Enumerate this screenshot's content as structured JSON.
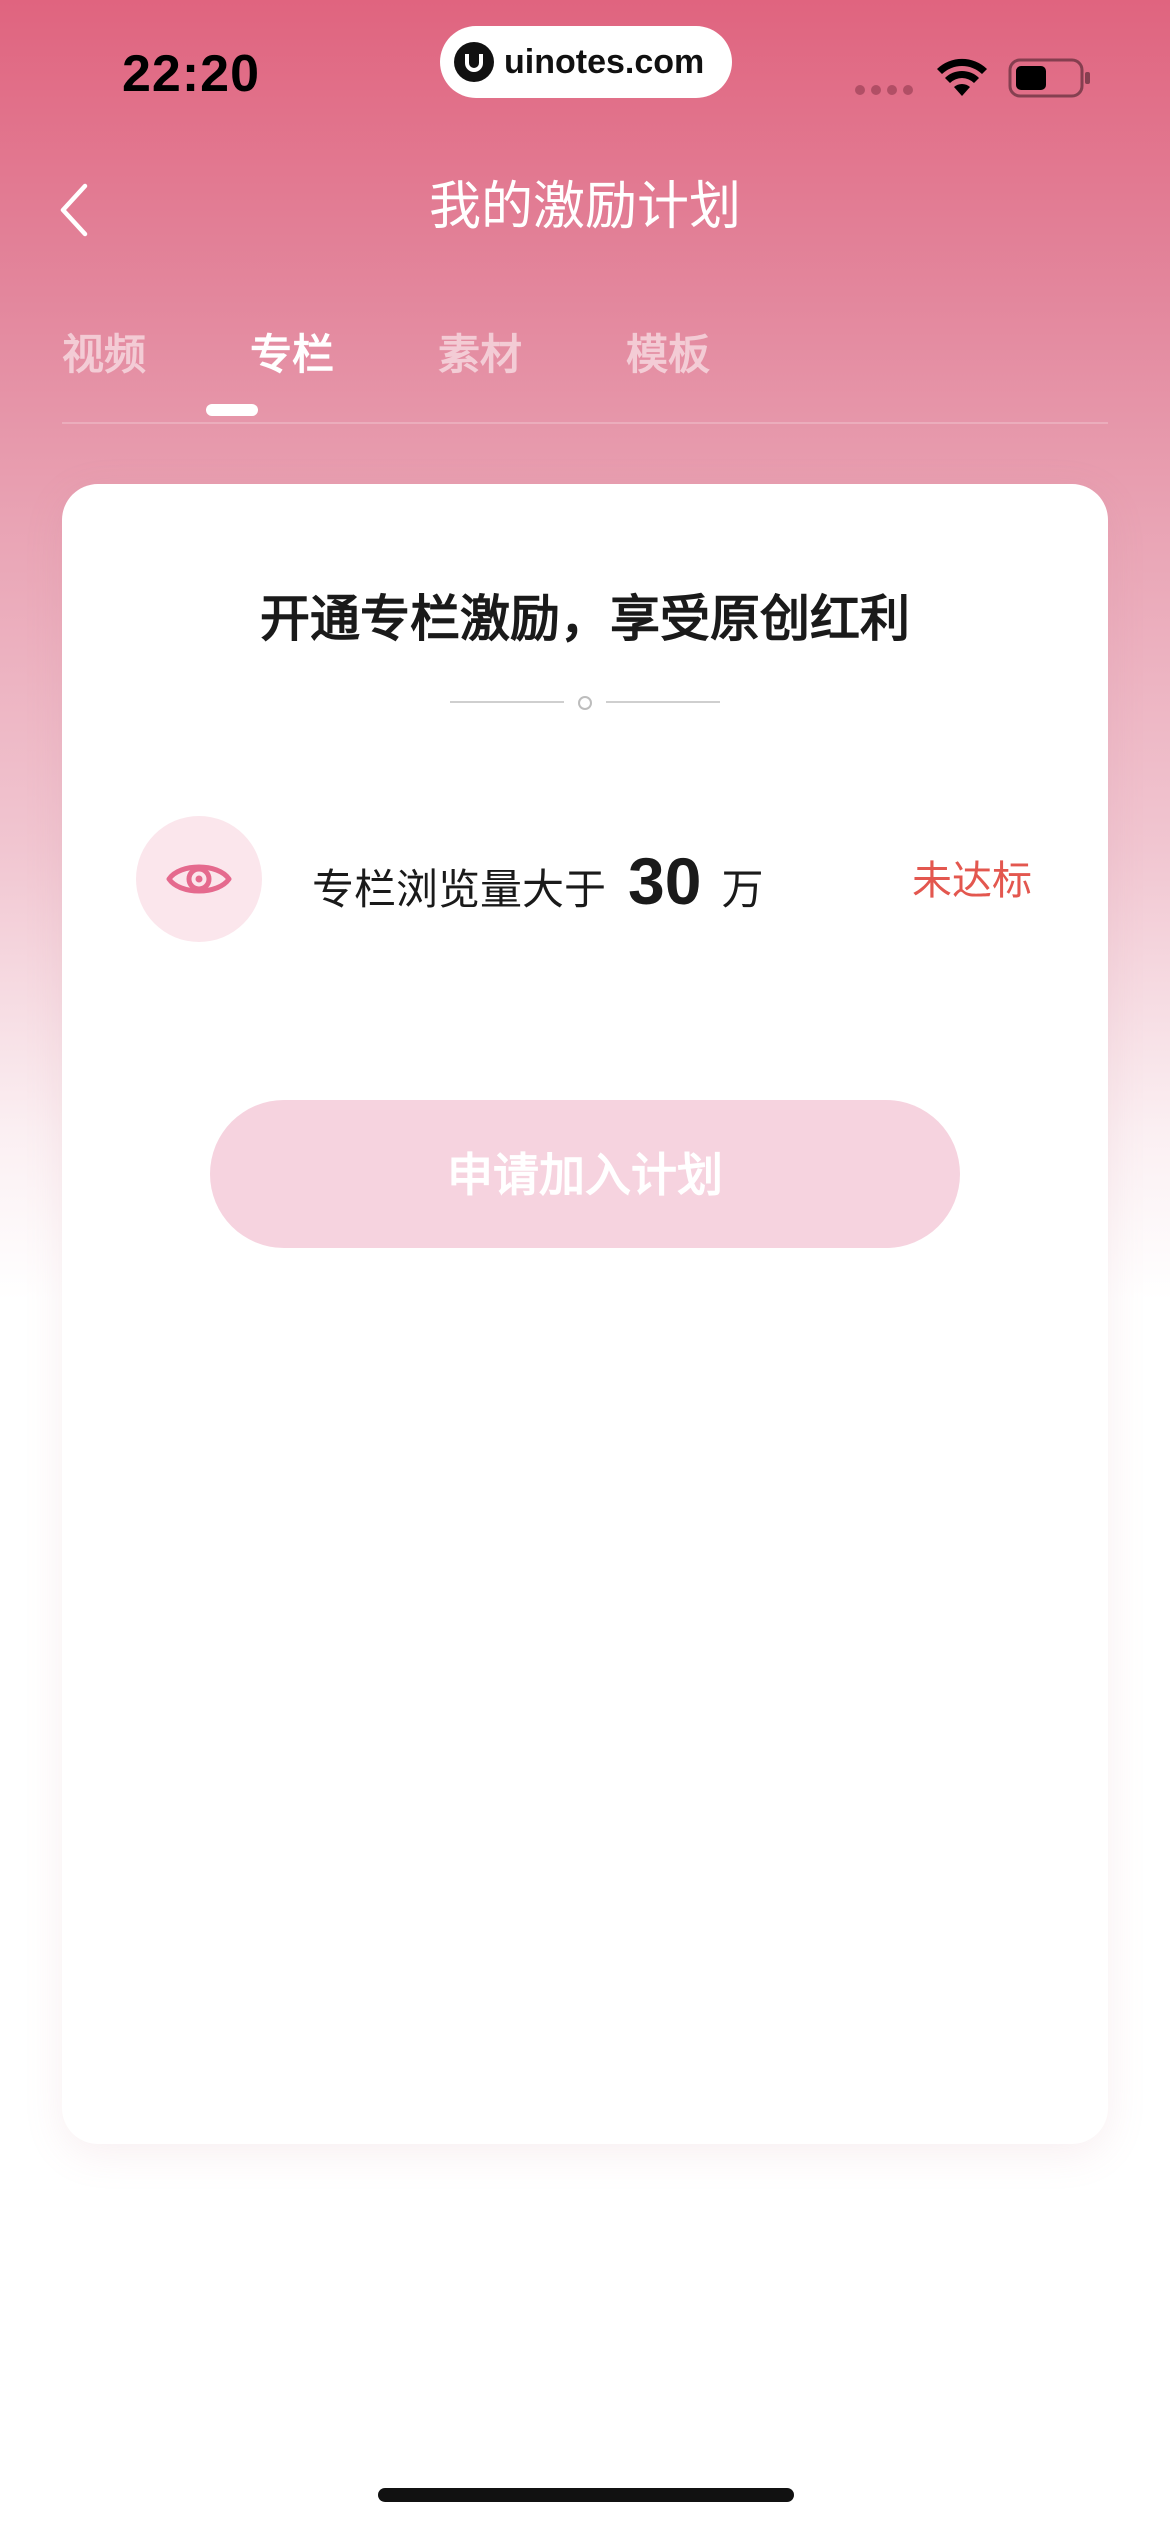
{
  "status_bar": {
    "time": "22:20",
    "watermark": "uinotes.com",
    "icons": [
      "signal-icon",
      "wifi-icon",
      "battery-icon"
    ]
  },
  "nav": {
    "title": "我的激励计划",
    "back_icon": "chevron-left-icon"
  },
  "tabs": [
    {
      "label": "视频",
      "active": false
    },
    {
      "label": "专栏",
      "active": true
    },
    {
      "label": "素材",
      "active": false
    },
    {
      "label": "模板",
      "active": false
    }
  ],
  "card": {
    "title": "开通专栏激励，享受原创红利",
    "requirement": {
      "icon": "eye-icon",
      "label": "专栏浏览量大于",
      "value": "30",
      "unit": "万",
      "status": "未达标"
    },
    "apply_button_label": "申请加入计划"
  },
  "colors": {
    "header_gradient_top": "#e0647f",
    "accent_pink": "#e56a8e",
    "status_red": "#e3574f",
    "button_disabled": "#f6d3df"
  }
}
